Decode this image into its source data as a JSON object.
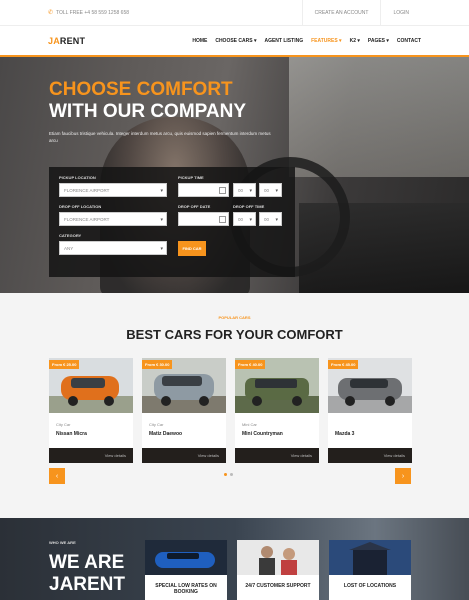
{
  "topbar": {
    "phone": "TOLL FREE +4 58 559 1258 658",
    "links": [
      "CREATE AN ACCOUNT",
      "LOGIN"
    ]
  },
  "nav": {
    "logo_accent": "JA",
    "logo_rest": "RENT",
    "items": [
      {
        "label": "HOME"
      },
      {
        "label": "CHOOSE CARS ▾"
      },
      {
        "label": "AGENT LISTING"
      },
      {
        "label": "FEATURES ▾"
      },
      {
        "label": "K2 ▾"
      },
      {
        "label": "PAGES ▾"
      },
      {
        "label": "CONTACT"
      }
    ]
  },
  "hero": {
    "title_line1": "CHOOSE COMFORT",
    "title_line2": "WITH OUR COMPANY",
    "text": "Etiam faucibus tristique vehicula. Integer interdum metus arcu, quis euismod sapien fermentum interdum metus arcu"
  },
  "booking": {
    "pickup_location_label": "PICKUP LOCATION",
    "pickup_location_value": "FLORENCE AIRPORT",
    "pickup_time_label": "PICKUP TIME",
    "pickup_hour": "00",
    "pickup_min": "00",
    "dropoff_location_label": "DROP OFF LOCATION",
    "dropoff_location_value": "FLORENCE AIRPORT",
    "dropoff_date_label": "DROP OFF DATE",
    "dropoff_time_label": "DROP OFF TIME",
    "dropoff_hour": "00",
    "dropoff_min": "00",
    "category_label": "CATEGORY",
    "category_value": "ANY",
    "find_button": "FIND CAR"
  },
  "best": {
    "eyebrow": "POPULAR CARS",
    "title": "BEST CARS FOR YOUR COMFORT",
    "cars": [
      {
        "price": "From € 25.00",
        "category": "City Car",
        "name": "Nissan Micra",
        "details": "View details",
        "color": "#e0701c"
      },
      {
        "price": "From € 30.00",
        "category": "City Car",
        "name": "Matiz Daewoo",
        "details": "View details",
        "color": "#8e9aa3"
      },
      {
        "price": "From € 40.00",
        "category": "Mini Car",
        "name": "Mini Countryman",
        "details": "View details",
        "color": "#5a6a44"
      },
      {
        "price": "From € 45.00",
        "category": "",
        "name": "Mazda 3",
        "details": "View details",
        "color": "#6d6f72"
      }
    ]
  },
  "about": {
    "eyebrow": "WHO WE ARE",
    "title_line1": "WE ARE",
    "title_line2": "JARENT",
    "features": [
      {
        "title": "SPECIAL LOW RATES ON BOOKING"
      },
      {
        "title": "24/7 CUSTOMER SUPPORT"
      },
      {
        "title": "LOST OF LOCATIONS"
      }
    ]
  },
  "colors": {
    "accent": "#f7941d",
    "dark": "#231f1c"
  }
}
